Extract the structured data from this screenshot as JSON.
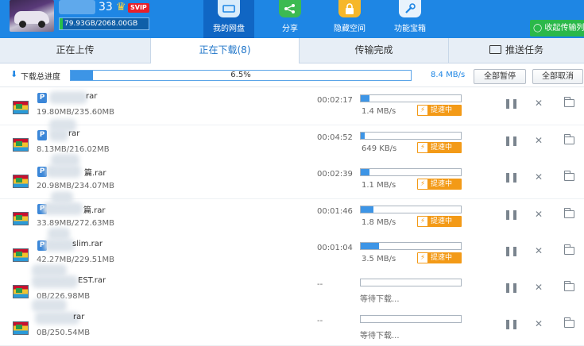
{
  "header": {
    "user_digits": "33",
    "vip_label": "SVIP",
    "quota_text": "79.93GB/2068.00GB",
    "quota_fraction": 0.04,
    "nav": [
      {
        "label": "我的网盘",
        "icon": "cloud-drive-icon",
        "active": true
      },
      {
        "label": "分享",
        "icon": "share-icon",
        "active": false
      },
      {
        "label": "隐藏空间",
        "icon": "lock-icon",
        "active": false
      },
      {
        "label": "功能宝箱",
        "icon": "toolbox-icon",
        "active": false
      }
    ],
    "collect_label": "收起传输列",
    "colors": {
      "header_bg": "#1e86e4",
      "nav_active_bg": "#1066c4",
      "collect_bg": "#2ab84a"
    }
  },
  "tabs": [
    {
      "label": "正在上传",
      "active": false
    },
    {
      "label": "正在下载(8)",
      "active": true
    },
    {
      "label": "传输完成",
      "active": false
    },
    {
      "label": "推送任务",
      "active": false
    }
  ],
  "overall": {
    "label": "下载总进度",
    "percent_text": "6.5%",
    "percent": 6.5,
    "speed": "8.4 MB/s",
    "pause_all": "全部暂停",
    "cancel_all": "全部取消"
  },
  "downloads": [
    {
      "name": "rar",
      "size": "19.80MB/235.60MB",
      "remaining": "00:02:17",
      "speed": "1.4 MB/s",
      "progress": 0.084,
      "boost": "提速中",
      "waiting": ""
    },
    {
      "name": "rar",
      "size": "8.13MB/216.02MB",
      "remaining": "00:04:52",
      "speed": "649 KB/s",
      "progress": 0.038,
      "boost": "提速中",
      "waiting": ""
    },
    {
      "name": "篇.rar",
      "size": "20.98MB/234.07MB",
      "remaining": "00:02:39",
      "speed": "1.1 MB/s",
      "progress": 0.09,
      "boost": "提速中",
      "waiting": ""
    },
    {
      "name": "篇.rar",
      "size": "33.89MB/272.63MB",
      "remaining": "00:01:46",
      "speed": "1.8 MB/s",
      "progress": 0.124,
      "boost": "提速中",
      "waiting": ""
    },
    {
      "name": "slim.rar",
      "size": "42.27MB/229.51MB",
      "remaining": "00:01:04",
      "speed": "3.5 MB/s",
      "progress": 0.184,
      "boost": "提速中",
      "waiting": ""
    },
    {
      "name": "EST.rar",
      "size": "0B/226.98MB",
      "remaining": "--",
      "speed": "",
      "progress": 0,
      "boost": "",
      "waiting": "等待下载..."
    },
    {
      "name": "rar",
      "size": "0B/250.54MB",
      "remaining": "--",
      "speed": "",
      "progress": 0,
      "boost": "",
      "waiting": "等待下载..."
    }
  ]
}
